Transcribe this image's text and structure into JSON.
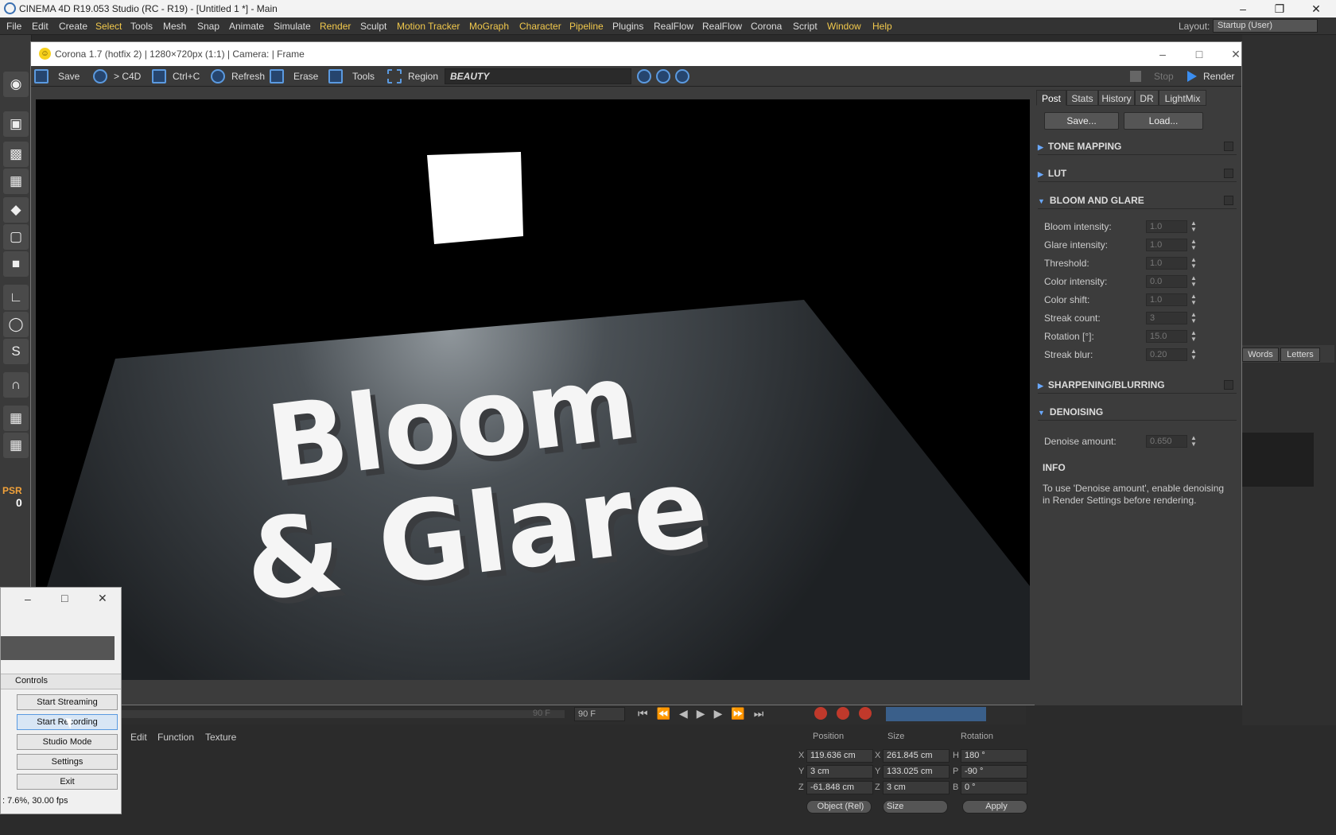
{
  "window": {
    "title": "CINEMA 4D R19.053 Studio (RC - R19) - [Untitled 1 *] - Main"
  },
  "menu": [
    "File",
    "Edit",
    "Create",
    "Select",
    "Tools",
    "Mesh",
    "Snap",
    "Animate",
    "Simulate",
    "Render",
    "Sculpt",
    "Motion Tracker",
    "MoGraph",
    "Character",
    "Pipeline",
    "Plugins",
    "RealFlow",
    "RealFlow",
    "Corona",
    "Script",
    "Window",
    "Help"
  ],
  "layout": {
    "label": "Layout:",
    "value": "Startup (User)"
  },
  "left_toolbar": {
    "psr_label": "PSR",
    "psr_value": "0"
  },
  "corona": {
    "title": "Corona 1.7 (hotfix 2) | 1280×720px (1:1) | Camera:  | Frame",
    "toolbar": {
      "save": "Save",
      "to_c4d": "> C4D",
      "copy": "Ctrl+C",
      "refresh": "Refresh",
      "erase": "Erase",
      "tools": "Tools",
      "region": "Region",
      "pass": "BEAUTY",
      "stop": "Stop",
      "render": "Render"
    },
    "render_text": {
      "line1": "Bloom",
      "line2": "& Glare"
    },
    "tabs": [
      "Post",
      "Stats",
      "History",
      "DR",
      "LightMix"
    ],
    "save_btn": "Save...",
    "load_btn": "Load...",
    "sections": {
      "tone_mapping": "TONE MAPPING",
      "lut": "LUT",
      "bloom": "BLOOM AND GLARE",
      "sharpen": "SHARPENING/BLURRING",
      "denoise": "DENOISING"
    },
    "bloom_params": [
      {
        "label": "Bloom intensity:",
        "value": "1.0"
      },
      {
        "label": "Glare intensity:",
        "value": "1.0"
      },
      {
        "label": "Threshold:",
        "value": "1.0"
      },
      {
        "label": "Color intensity:",
        "value": "0.0"
      },
      {
        "label": "Color shift:",
        "value": "1.0"
      },
      {
        "label": "Streak count:",
        "value": "3"
      },
      {
        "label": "Rotation [°]:",
        "value": "15.0"
      },
      {
        "label": "Streak blur:",
        "value": "0.20"
      }
    ],
    "denoise": {
      "label": "Denoise amount:",
      "value": "0.650"
    },
    "info": {
      "title": "INFO",
      "text": "To use 'Denoise amount', enable denoising in Render Settings before rendering."
    }
  },
  "side_tabs": {
    "words": "Words",
    "letters": "Letters"
  },
  "timeline": {
    "frame_a": "90 F",
    "frame_b": "90 F"
  },
  "bottom_menu": [
    "Edit",
    "Function",
    "Texture"
  ],
  "coords": {
    "headers": {
      "position": "Position",
      "size": "Size",
      "rotation": "Rotation"
    },
    "rows": [
      {
        "axis": "X",
        "pos": "119.636 cm",
        "saxis": "X",
        "size": "261.845 cm",
        "raxis": "H",
        "rot": "180 °"
      },
      {
        "axis": "Y",
        "pos": "3 cm",
        "saxis": "Y",
        "size": "133.025 cm",
        "raxis": "P",
        "rot": "-90 °"
      },
      {
        "axis": "Z",
        "pos": "-61.848 cm",
        "saxis": "Z",
        "size": "3 cm",
        "raxis": "B",
        "rot": "0 °"
      }
    ],
    "mode": "Object (Rel)",
    "size_mode": "Size",
    "apply": "Apply"
  },
  "obs": {
    "controls_label": "Controls",
    "buttons": [
      "Start Streaming",
      "Start Recording",
      "Studio Mode",
      "Settings",
      "Exit"
    ],
    "status": ": 7.6%, 30.00 fps"
  }
}
